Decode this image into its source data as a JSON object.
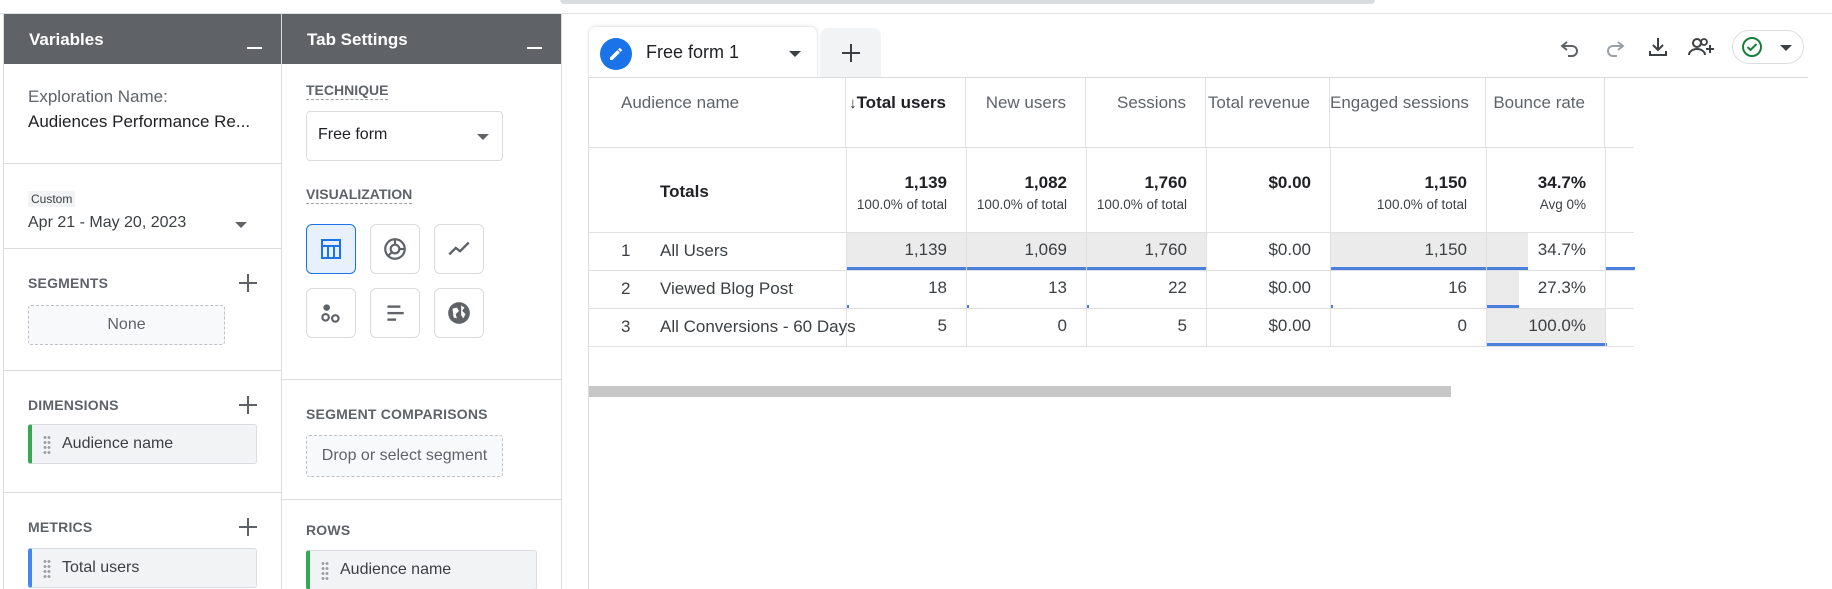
{
  "variables_panel": {
    "title": "Variables",
    "exploration_label": "Exploration Name:",
    "exploration_name": "Audiences Performance Re...",
    "date_tag": "Custom",
    "date_range": "Apr 21 - May 20, 2023",
    "segments_title": "SEGMENTS",
    "segments_value": "None",
    "dimensions_title": "DIMENSIONS",
    "dimensions": [
      "Audience name"
    ],
    "metrics_title": "METRICS",
    "metrics": [
      "Total users"
    ]
  },
  "tab_settings": {
    "title": "Tab Settings",
    "technique_title": "TECHNIQUE",
    "technique_value": "Free form",
    "visualization_title": "VISUALIZATION",
    "visualizations": [
      {
        "name": "table",
        "active": true
      },
      {
        "name": "donut",
        "active": false
      },
      {
        "name": "line",
        "active": false
      },
      {
        "name": "scatter",
        "active": false
      },
      {
        "name": "bar",
        "active": false
      },
      {
        "name": "geo",
        "active": false
      }
    ],
    "segment_comparisons_title": "SEGMENT COMPARISONS",
    "segment_drop": "Drop or select segment",
    "rows_title": "ROWS",
    "rows": [
      "Audience name"
    ]
  },
  "main": {
    "tab_label": "Free form 1",
    "toolbar": [
      "undo-icon",
      "redo-icon",
      "download-icon",
      "share-users-icon",
      "check-status-icon"
    ],
    "accent": "#1a73e8"
  },
  "table": {
    "dimension_header": "Audience name",
    "sort_arrow": "↓",
    "headers": [
      "Total users",
      "New users",
      "Sessions",
      "Total revenue",
      "Engaged sessions",
      "Bounce rate"
    ],
    "totals_label": "Totals",
    "totals": [
      {
        "value": "1,139",
        "sub": "100.0% of total"
      },
      {
        "value": "1,082",
        "sub": "100.0% of total"
      },
      {
        "value": "1,760",
        "sub": "100.0% of total"
      },
      {
        "value": "$0.00",
        "sub": ""
      },
      {
        "value": "1,150",
        "sub": "100.0% of total"
      },
      {
        "value": "34.7%",
        "sub": "Avg 0%"
      }
    ],
    "rows": [
      {
        "index": "1",
        "name": "All Users",
        "values": [
          "1,139",
          "1,069",
          "1,760",
          "$0.00",
          "1,150",
          "34.7%"
        ]
      },
      {
        "index": "2",
        "name": "Viewed Blog Post",
        "values": [
          "18",
          "13",
          "22",
          "$0.00",
          "16",
          "27.3%"
        ]
      },
      {
        "index": "3",
        "name": "All Conversions - 60 Days",
        "values": [
          "5",
          "0",
          "5",
          "$0.00",
          "0",
          "100.0%"
        ]
      }
    ]
  }
}
